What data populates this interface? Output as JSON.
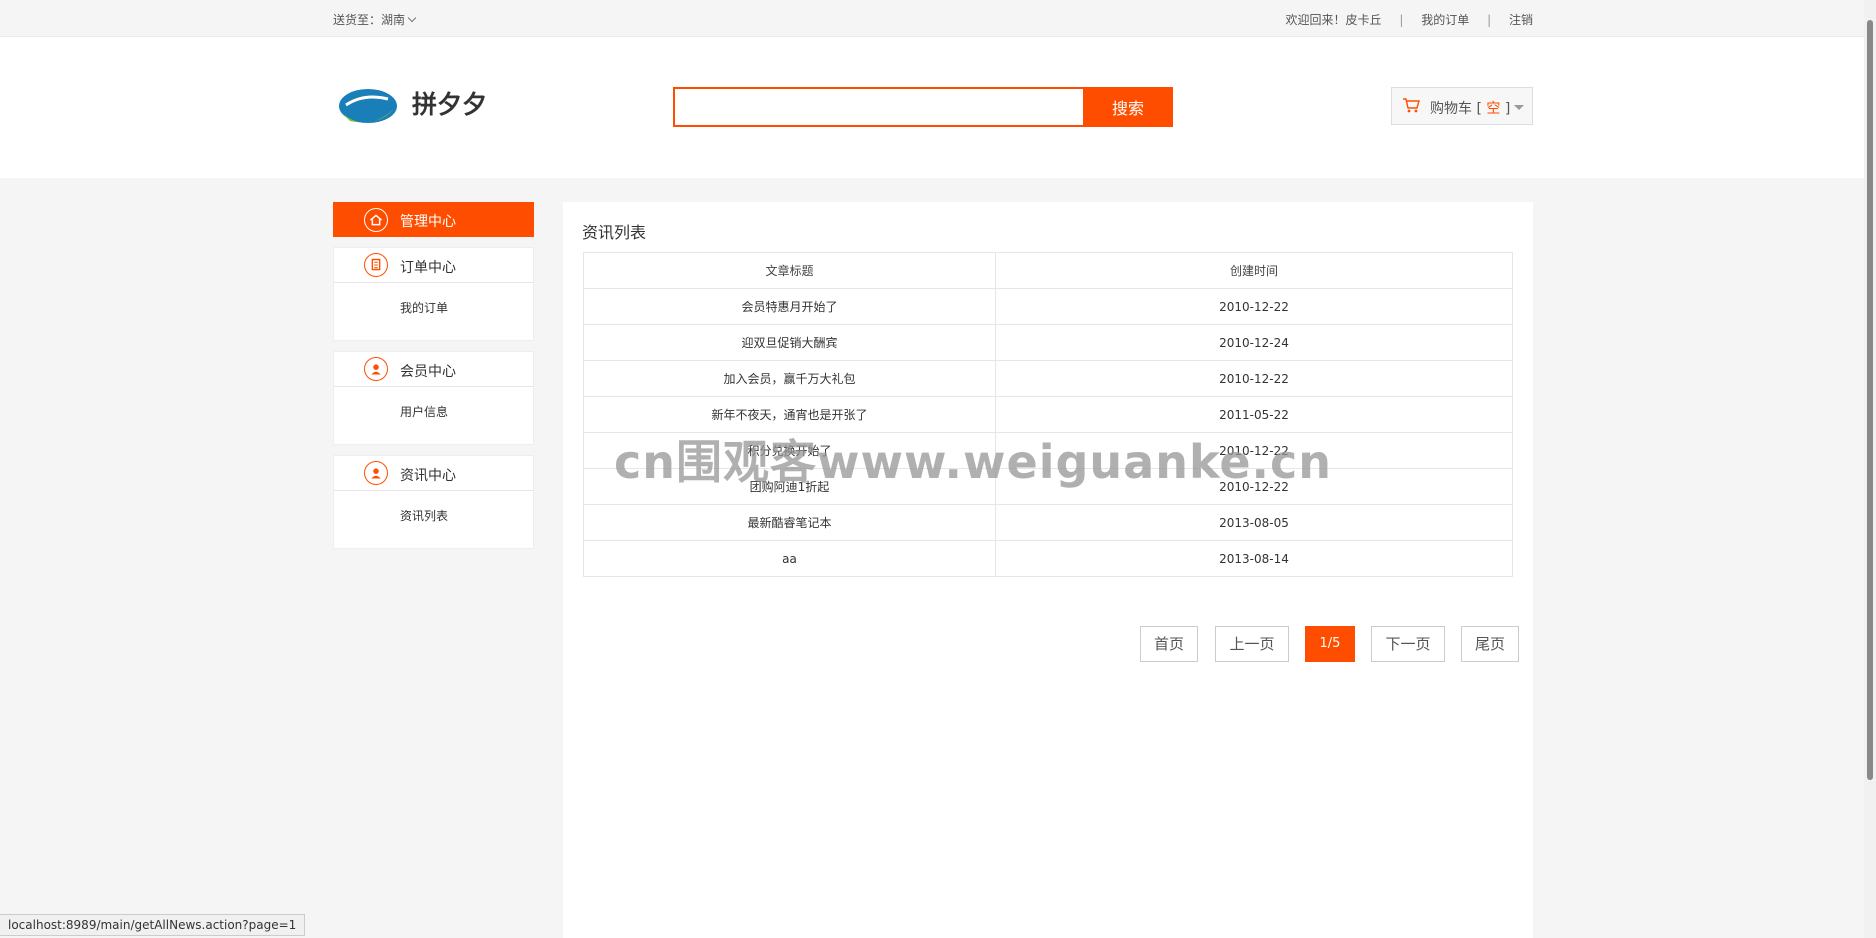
{
  "topbar": {
    "ship_to_label": "送货至：",
    "ship_to_value": "湖南",
    "welcome": "欢迎回来！皮卡丘",
    "sep": "|",
    "my_orders": "我的订单",
    "logout": "注销"
  },
  "header": {
    "logo_text": "拼夕夕",
    "search_placeholder": "",
    "search_button": "搜索",
    "cart_label": "购物车 [ ",
    "cart_status": "空",
    "cart_close": " ]"
  },
  "sidebar": {
    "active": {
      "label": "管理中心",
      "icon": "home-icon"
    },
    "groups": [
      {
        "label": "订单中心",
        "icon": "document-icon",
        "items": [
          "我的订单"
        ]
      },
      {
        "label": "会员中心",
        "icon": "user-icon",
        "items": [
          "用户信息"
        ]
      },
      {
        "label": "资讯中心",
        "icon": "user-icon",
        "items": [
          "资讯列表"
        ]
      }
    ]
  },
  "main": {
    "title": "资讯列表",
    "columns": [
      "文章标题",
      "创建时间"
    ],
    "rows": [
      [
        "会员特惠月开始了",
        "2010-12-22"
      ],
      [
        "迎双旦促销大酬宾",
        "2010-12-24"
      ],
      [
        "加入会员，赢千万大礼包",
        "2010-12-22"
      ],
      [
        "新年不夜天，通宵也是开张了",
        "2011-05-22"
      ],
      [
        "积分兑换开始了",
        "2010-12-22"
      ],
      [
        "团购阿迪1折起",
        "2010-12-22"
      ],
      [
        "最新酷睿笔记本",
        "2013-08-05"
      ],
      [
        "aa",
        "2013-08-14"
      ]
    ],
    "pager": {
      "first": "首页",
      "prev": "上一页",
      "current": "1/5",
      "next": "下一页",
      "last": "尾页"
    }
  },
  "status_bar": "localhost:8989/main/getAllNews.action?page=1",
  "watermark": "cn围观客www.weiguanke.cn",
  "colors": {
    "accent": "#ff4d00",
    "logo_blue": "#1a7fb8",
    "logo_green": "#7bbf3a"
  }
}
